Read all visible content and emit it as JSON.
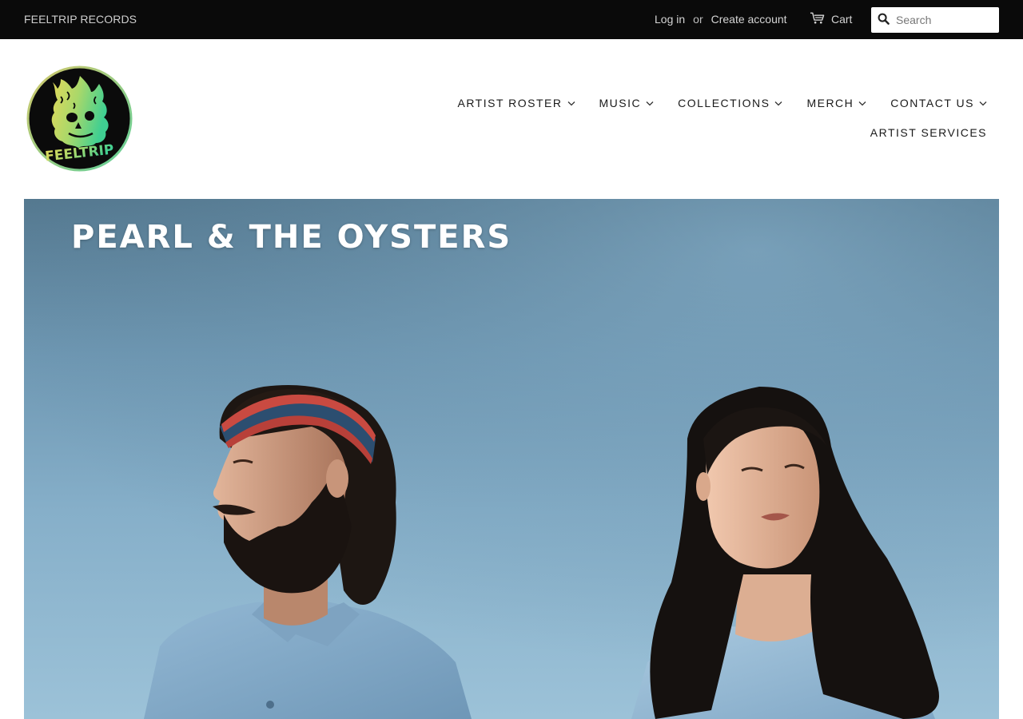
{
  "topbar": {
    "store_name": "FEELTRIP RECORDS",
    "login_label": "Log in",
    "or_label": "or",
    "create_account_label": "Create account",
    "cart_label": "Cart",
    "search_placeholder": "Search"
  },
  "logo": {
    "text": "FEELTRIP",
    "colors": {
      "ring": "#c8c46a",
      "fill": "#0b0b0b",
      "yellow": "#e0dd5e",
      "green": "#4fce8a"
    }
  },
  "nav": {
    "items": [
      {
        "label": "ARTIST ROSTER",
        "has_dropdown": true
      },
      {
        "label": "MUSIC",
        "has_dropdown": true
      },
      {
        "label": "COLLECTIONS",
        "has_dropdown": true
      },
      {
        "label": "MERCH",
        "has_dropdown": true
      },
      {
        "label": "CONTACT US",
        "has_dropdown": true
      }
    ],
    "second_row": {
      "label": "ARTIST SERVICES",
      "has_dropdown": false
    }
  },
  "hero": {
    "title": "PEARL & THE OYSTERS",
    "image": "band-photo-two-people-against-blue-sky"
  },
  "icons": {
    "cart": "cart-icon",
    "search": "search-icon",
    "chevron": "chevron-down-icon"
  }
}
